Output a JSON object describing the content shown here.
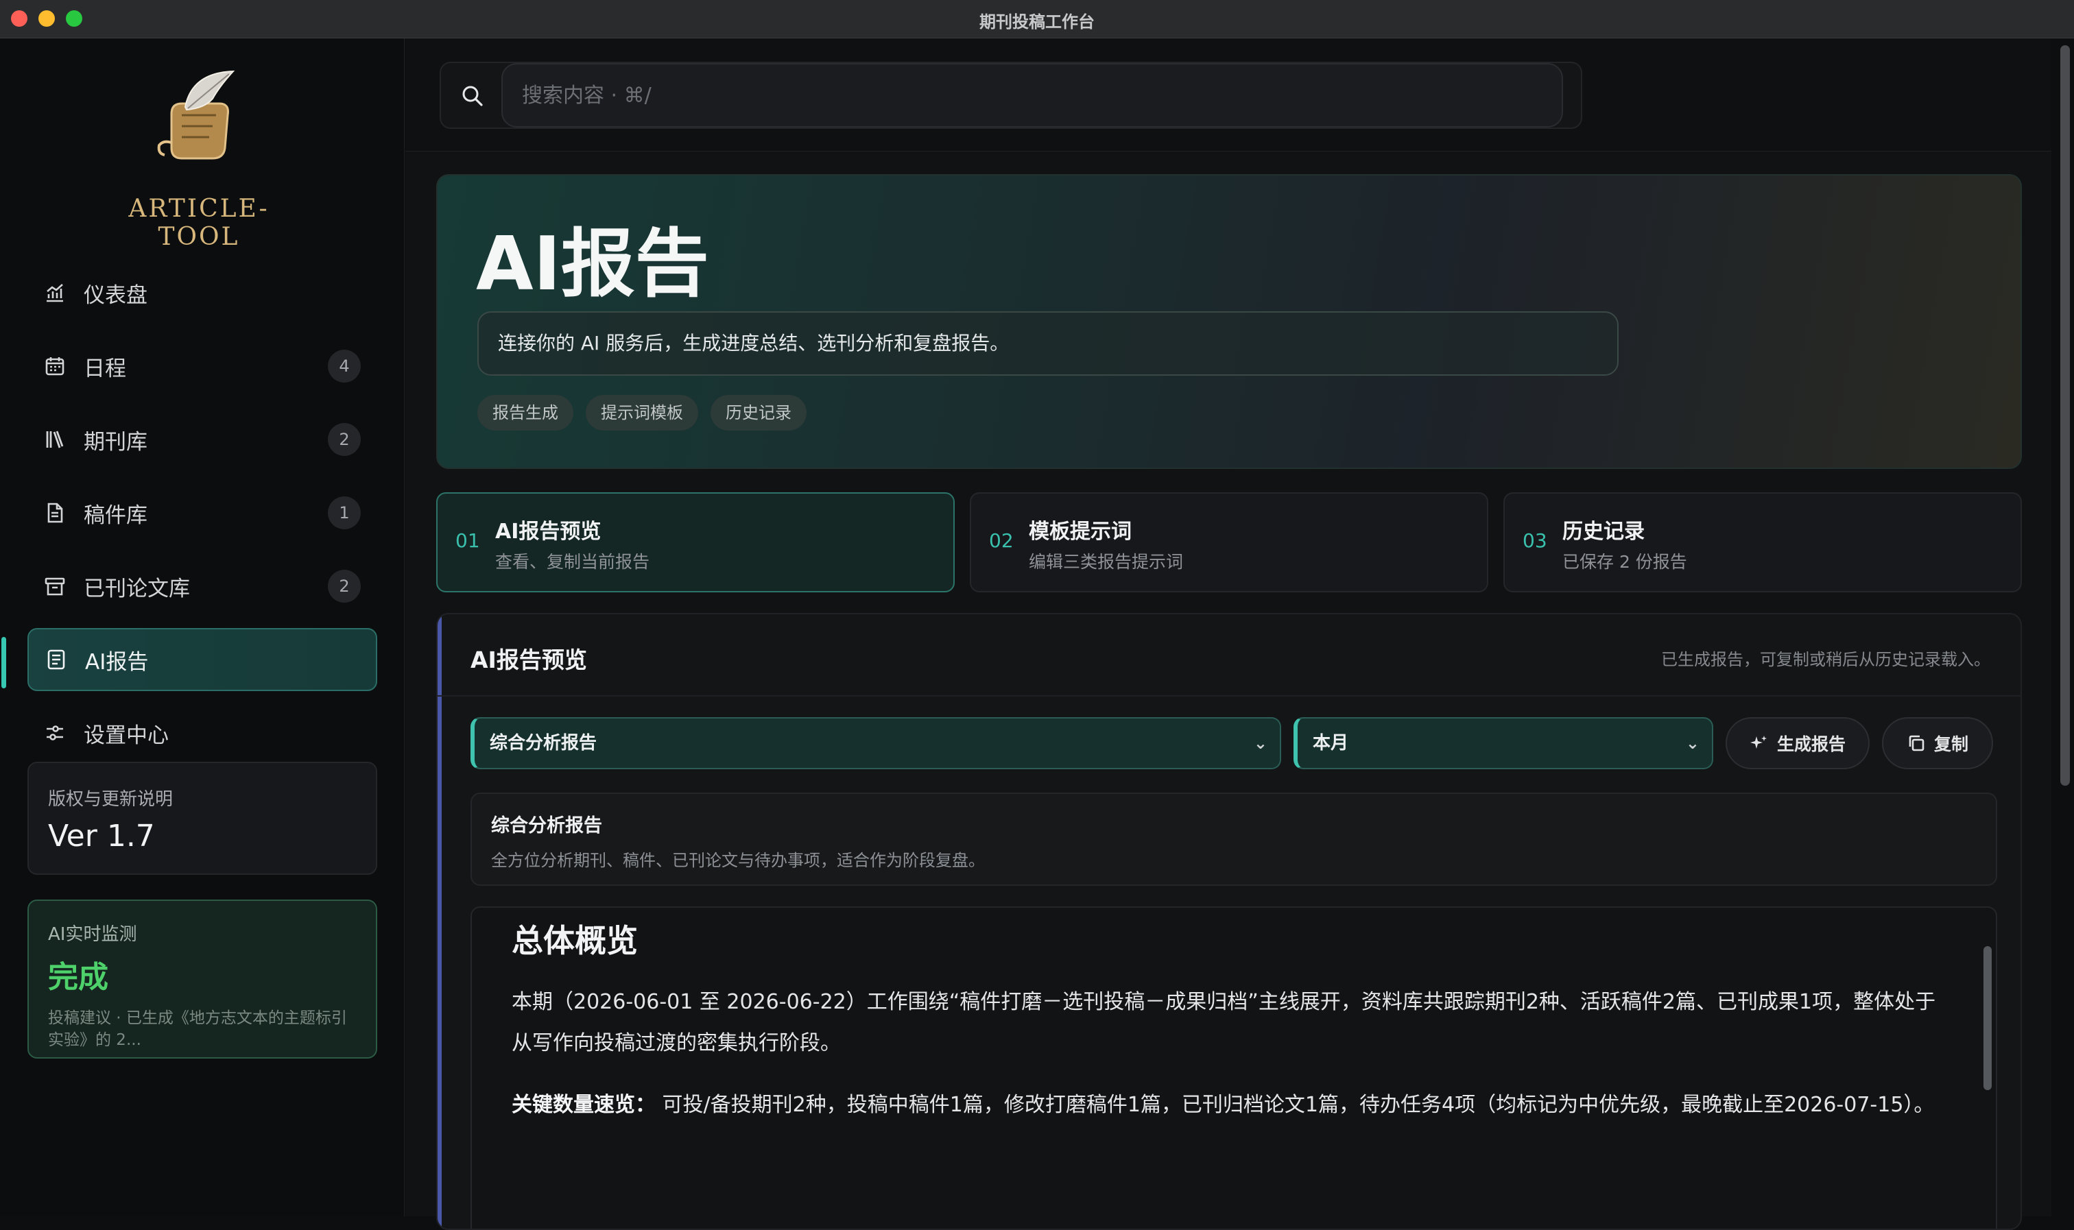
{
  "window": {
    "title": "期刊投稿工作台"
  },
  "sidebar": {
    "logo_text": "ARTICLE-TOOL",
    "items": [
      {
        "label": "仪表盘",
        "icon": "chart-icon",
        "badge": ""
      },
      {
        "label": "日程",
        "icon": "calendar-icon",
        "badge": "4"
      },
      {
        "label": "期刊库",
        "icon": "books-icon",
        "badge": "2"
      },
      {
        "label": "稿件库",
        "icon": "document-icon",
        "badge": "1"
      },
      {
        "label": "已刊论文库",
        "icon": "archive-icon",
        "badge": "2"
      },
      {
        "label": "AI报告",
        "icon": "report-icon",
        "badge": "",
        "active": true
      },
      {
        "label": "设置中心",
        "icon": "settings-icon",
        "badge": ""
      }
    ],
    "version_card": {
      "label": "版权与更新说明",
      "value": "Ver 1.7"
    },
    "monitor_card": {
      "label": "AI实时监测",
      "status": "完成",
      "desc": "投稿建议 · 已生成《地方志文本的主题标引实验》的 2..."
    }
  },
  "search": {
    "placeholder": "搜索内容 · ⌘/"
  },
  "hero": {
    "title": "AI报告",
    "desc": "连接你的 AI 服务后，生成进度总结、选刊分析和复盘报告。",
    "tags": [
      "报告生成",
      "提示词模板",
      "历史记录"
    ]
  },
  "steps": [
    {
      "num": "01",
      "title": "AI报告预览",
      "sub": "查看、复制当前报告"
    },
    {
      "num": "02",
      "title": "模板提示词",
      "sub": "编辑三类报告提示词"
    },
    {
      "num": "03",
      "title": "历史记录",
      "sub": "已保存 2 份报告"
    }
  ],
  "panel": {
    "title": "AI报告预览",
    "note": "已生成报告，可复制或稍后从历史记录载入。",
    "report_type": "综合分析报告",
    "period": "本月",
    "generate_label": "生成报告",
    "copy_label": "复制",
    "info_title": "综合分析报告",
    "info_sub": "全方位分析期刊、稿件、已刊论文与待办事项，适合作为阶段复盘。"
  },
  "report": {
    "heading": "总体概览",
    "para1": "本期（2026-06-01 至 2026-06-22）工作围绕“稿件打磨－选刊投稿－成果归档”主线展开，资料库共跟踪期刊2种、活跃稿件2篇、已刊成果1项，整体处于从写作向投稿过渡的密集执行阶段。",
    "para2_label": "关键数量速览：",
    "para2": "可投/备投期刊2种，投稿中稿件1篇，修改打磨稿件1篇，已刊归档论文1篇，待办任务4项（均标记为中优先级，最晚截止至2026-07-15）。"
  },
  "colors": {
    "accent": "#37c8b3",
    "success": "#4ed16a",
    "logo_gold": "#d8b77d"
  }
}
